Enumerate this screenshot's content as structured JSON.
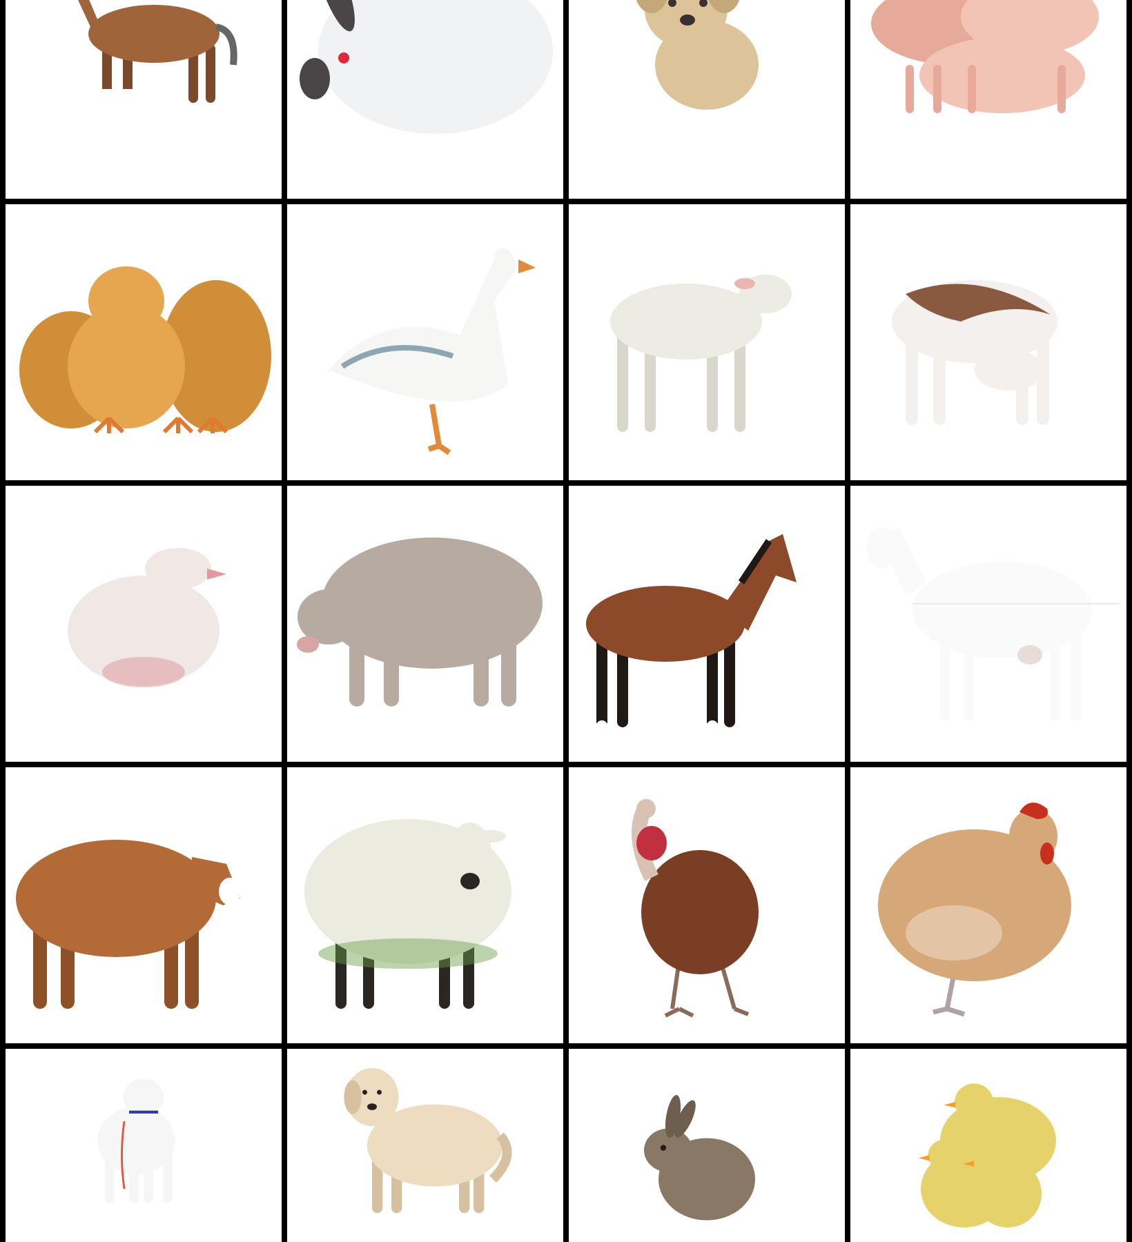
{
  "grid": {
    "rows": 5,
    "columns": 4,
    "line_color": "#000000",
    "cell_background": "#ffffff"
  },
  "cells": [
    {
      "subject": "foal-icon",
      "colors": [
        "#a0643a",
        "#7a4a2a",
        "#ffffff"
      ]
    },
    {
      "subject": "rabbit-icon",
      "colors": [
        "#f1f2f4",
        "#4a4648",
        "#e0283a"
      ]
    },
    {
      "subject": "puppy-icon",
      "colors": [
        "#dcc39a",
        "#c4a87a",
        "#3a3030"
      ]
    },
    {
      "subject": "piglets-icon",
      "colors": [
        "#f1c4b6",
        "#e6aa9a"
      ]
    },
    {
      "subject": "chicks-icon",
      "colors": [
        "#e6a650",
        "#d08e38",
        "#e07a30"
      ]
    },
    {
      "subject": "goose-icon",
      "colors": [
        "#f6f6f4",
        "#e08a3a",
        "#8ea6b4"
      ]
    },
    {
      "subject": "lamb-icon",
      "colors": [
        "#ecebe4",
        "#d9d6cc",
        "#e8b8b0"
      ]
    },
    {
      "subject": "calf-icon",
      "colors": [
        "#f4f0ee",
        "#8a5a40"
      ]
    },
    {
      "subject": "gosling-icon",
      "colors": [
        "#f0e8e4",
        "#e09aa0"
      ]
    },
    {
      "subject": "pig-icon",
      "colors": [
        "#b7aaa1",
        "#d8a6a2"
      ]
    },
    {
      "subject": "horse-icon",
      "colors": [
        "#8c4a2a",
        "#1f1814",
        "#ffffff"
      ]
    },
    {
      "subject": "goat-icon",
      "colors": [
        "#fafafa",
        "#e8dcd8"
      ]
    },
    {
      "subject": "cow-icon",
      "colors": [
        "#b46a36",
        "#8e5028",
        "#ffffff"
      ]
    },
    {
      "subject": "sheep-icon",
      "colors": [
        "#ecebe0",
        "#2a2624",
        "#6aa04a"
      ]
    },
    {
      "subject": "turkey-icon",
      "colors": [
        "#7a3e24",
        "#c23040",
        "#d8c2b4"
      ]
    },
    {
      "subject": "hen-icon",
      "colors": [
        "#d6a878",
        "#c8301e",
        "#f0e2d2"
      ]
    },
    {
      "subject": "kid-goat-icon",
      "colors": [
        "#f6f6f6",
        "#e8503a",
        "#2a3aa0"
      ]
    },
    {
      "subject": "dog-icon",
      "colors": [
        "#eddcc0",
        "#d6c0a0",
        "#2a2020"
      ]
    },
    {
      "subject": "bunny-icon",
      "colors": [
        "#8a7866",
        "#6e5e50"
      ]
    },
    {
      "subject": "ducklings-icon",
      "colors": [
        "#e6d26a",
        "#f0a030"
      ]
    }
  ]
}
